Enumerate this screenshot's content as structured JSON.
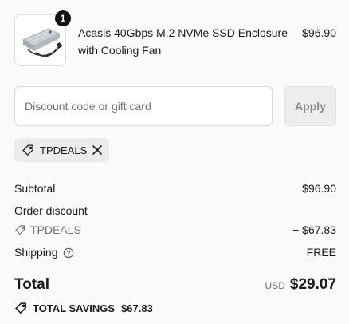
{
  "product": {
    "name": "Acasis 40Gbps M.2 NVMe SSD Enclosure with Cooling Fan",
    "price": "$96.90",
    "quantity": "1",
    "image_icon": "ssd-enclosure-image"
  },
  "discount": {
    "placeholder": "Discount code or gift card",
    "value": "",
    "apply_label": "Apply",
    "applied_code": "TPDEALS"
  },
  "summary": {
    "subtotal_label": "Subtotal",
    "subtotal_value": "$96.90",
    "order_discount_label": "Order discount",
    "discount_code": "TPDEALS",
    "discount_value": "− $67.83",
    "shipping_label": "Shipping",
    "shipping_value": "FREE",
    "total_label": "Total",
    "currency": "USD",
    "total_value": "$29.07",
    "savings_label": "TOTAL SAVINGS",
    "savings_value": "$67.83"
  }
}
